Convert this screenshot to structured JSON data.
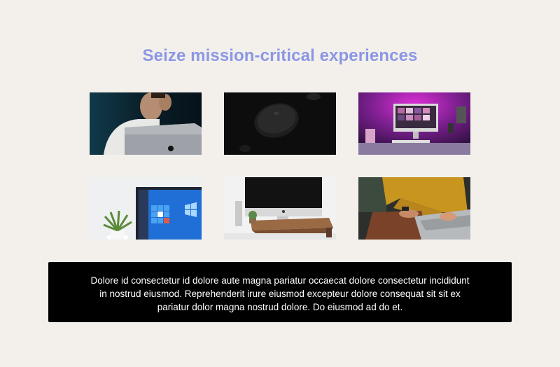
{
  "header": {
    "title": "Seize mission-critical experiences"
  },
  "gallery": {
    "images": [
      {
        "label": "person-with-laptop"
      },
      {
        "label": "computer-mouse"
      },
      {
        "label": "imac-pink-light"
      },
      {
        "label": "windows-laptop-plant"
      },
      {
        "label": "imac-on-desk"
      },
      {
        "label": "typing-on-laptop"
      }
    ]
  },
  "panel": {
    "text": "Dolore id consectetur id dolore aute magna pariatur occaecat dolore consectetur incididunt in nostrud eiusmod. Reprehenderit irure eiusmod excepteur dolore consequat sit sit ex pariatur dolor magna nostrud dolore. Do eiusmod ad do et."
  },
  "colors": {
    "background": "#f3f0ec",
    "title": "#8b97e4",
    "panel": "#000000",
    "panel_text": "#ffffff"
  }
}
